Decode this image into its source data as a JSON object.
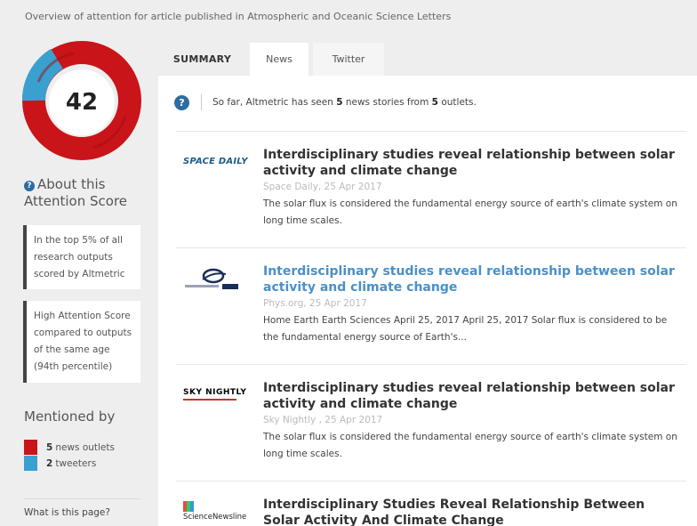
{
  "header": {
    "subtitle": "Overview of attention for article published in Atmospheric and Oceanic Science Letters"
  },
  "score": {
    "value": "42",
    "about_label": "About this Attention Score",
    "callouts": [
      "In the top 5% of all research outputs scored by Altmetric",
      "High Attention Score compared to outputs of the same age (94th percentile)"
    ],
    "mentioned_by_label": "Mentioned by",
    "legend": [
      {
        "count": "5",
        "label": "news outlets",
        "color": "#c9141a"
      },
      {
        "count": "2",
        "label": "tweeters",
        "color": "#3aa0d0"
      }
    ],
    "what_is_link": "What is this page?"
  },
  "tabs": [
    {
      "label": "SUMMARY",
      "active": false
    },
    {
      "label": "News",
      "active": true
    },
    {
      "label": "Twitter",
      "active": false
    }
  ],
  "info": {
    "prefix": "So far, Altmetric has seen",
    "stories": "5",
    "middle": "news stories from",
    "outlets": "5",
    "suffix": "outlets."
  },
  "stories": [
    {
      "logo_icon": "space-daily-logo",
      "logo_text": "SPACE DAILY",
      "headline": "Interdisciplinary studies reveal relationship between solar activity and climate change",
      "meta": "Space Daily, 25 Apr 2017",
      "snippet": "The solar flux is considered the fundamental energy source of earth's climate system on long time scales."
    },
    {
      "logo_icon": "phys-org-logo",
      "headline": "Interdisciplinary studies reveal relationship between solar activity and climate change",
      "meta": "Phys.org, 25 Apr 2017",
      "snippet": "Home Earth Earth Sciences April 25, 2017 April 25, 2017 Solar flux is considered to be the fundamental energy source of Earth's..."
    },
    {
      "logo_icon": "sky-nightly-logo",
      "logo_text": "SKY NIGHTLY",
      "headline": "Interdisciplinary studies reveal relationship between solar activity and climate change",
      "meta": "Sky Nightly , 25 Apr 2017",
      "snippet": "The solar flux is considered the fundamental energy source of earth's climate system on long time scales."
    },
    {
      "logo_icon": "science-newsline-logo",
      "logo_text": "ScienceNewsline",
      "headline": "Interdisciplinary Studies Reveal Relationship Between Solar Activity And Climate Change",
      "meta": "",
      "snippet": ""
    }
  ],
  "colors": {
    "donut_red": "#c9141a",
    "donut_blue": "#3aa0d0",
    "accent_blue": "#2d6ca2",
    "link_blue": "#4a90c8"
  }
}
